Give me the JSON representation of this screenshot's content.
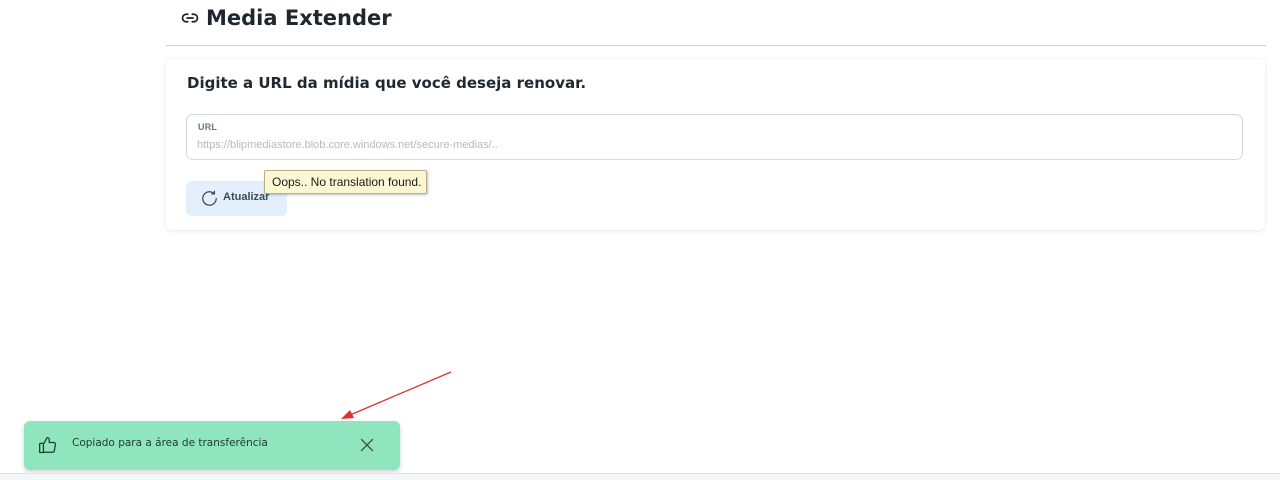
{
  "header": {
    "title": "Media Extender",
    "icon": "link-icon"
  },
  "card": {
    "title": "Digite a URL da mídia que você deseja renovar.",
    "url_field": {
      "label": "URL",
      "value": "",
      "placeholder": "https://blipmediastore.blob.core.windows.net/secure-medias/.."
    },
    "refresh_button": {
      "label": "Atualizar",
      "icon": "refresh-icon"
    }
  },
  "tooltip": {
    "text": "Oops.. No translation found."
  },
  "toast": {
    "message": "Copiado para a área de transferência",
    "icon": "thumbs-up-icon",
    "close_icon": "close-icon",
    "color": "#8fe5bd"
  },
  "annotation": {
    "color": "#e03131"
  }
}
